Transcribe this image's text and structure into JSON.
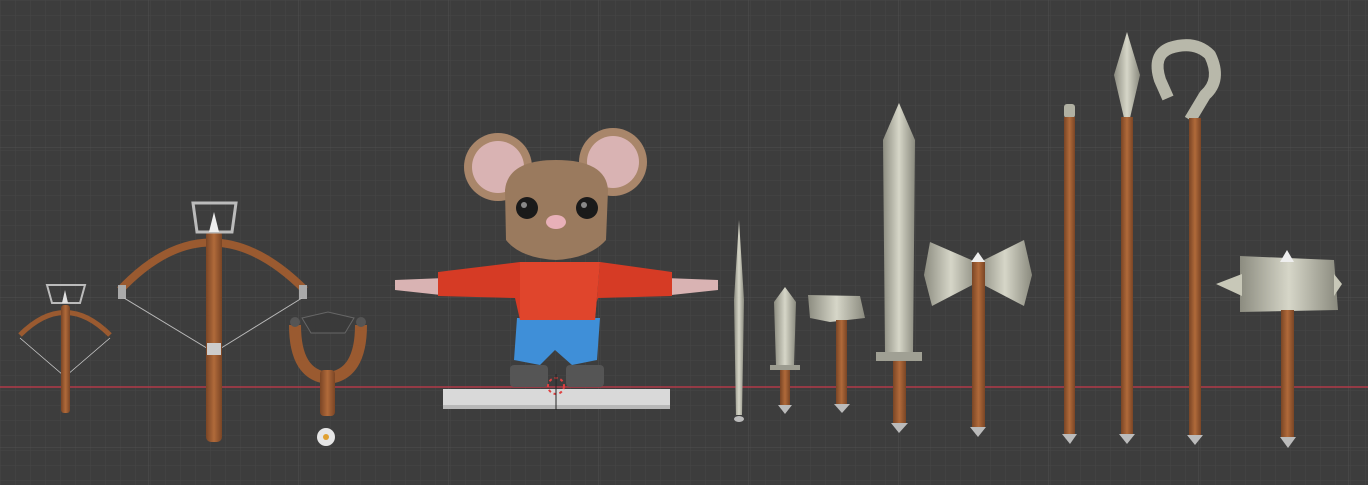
{
  "viewport": {
    "name": "3D Viewport",
    "background_color": "#3d3d3d",
    "grid_color_minor": "#474747",
    "grid_color_major": "#525252",
    "x_axis_color": "#b13a48"
  },
  "scene": {
    "objects": [
      "crossbow-small",
      "crossbow-large",
      "slingshot",
      "mouse-character",
      "needle",
      "dagger",
      "hammer-small",
      "longsword",
      "double-axe",
      "staff",
      "spear",
      "crook-staff",
      "warhammer"
    ],
    "colors": {
      "wood": "#9a5a30",
      "wood_dark": "#6e3e20",
      "metal": "#b5b5a4",
      "metal_dark": "#7e7e72",
      "mouse_fur": "#9a7a5e",
      "mouse_ear_inner": "#d9b3b3",
      "shirt": "#d63b25",
      "shorts": "#3f8fd8",
      "platform": "#d9d9d9"
    }
  }
}
